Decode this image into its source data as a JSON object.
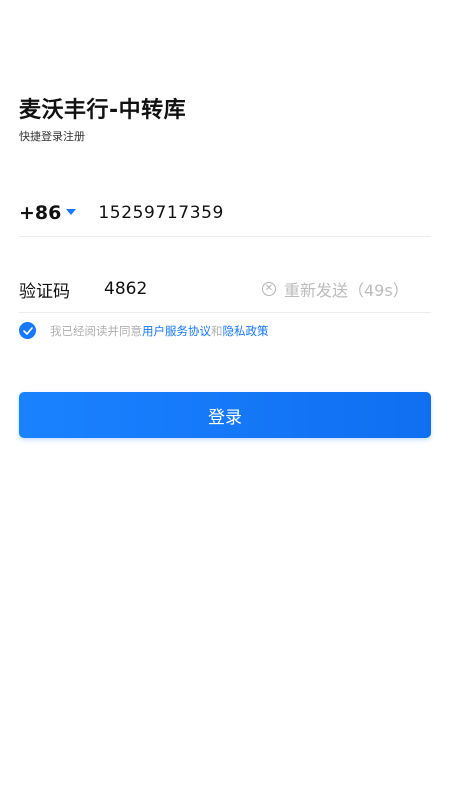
{
  "header": {
    "title": "麦沃丰行-中转库",
    "subtitle": "快捷登录注册"
  },
  "phone": {
    "country_code": "+86",
    "value": "15259717359"
  },
  "verification": {
    "label": "验证码",
    "value": "4862",
    "resend_label": "重新发送（49s）"
  },
  "agreement": {
    "checked": true,
    "prefix": "我已经阅读并同意",
    "link_terms": "用户服务协议",
    "conjunction": "和",
    "link_privacy": "隐私政策"
  },
  "login_button": {
    "label": "登录"
  },
  "colors": {
    "accent": "#1677ff",
    "muted_text": "#b0b0b0"
  }
}
